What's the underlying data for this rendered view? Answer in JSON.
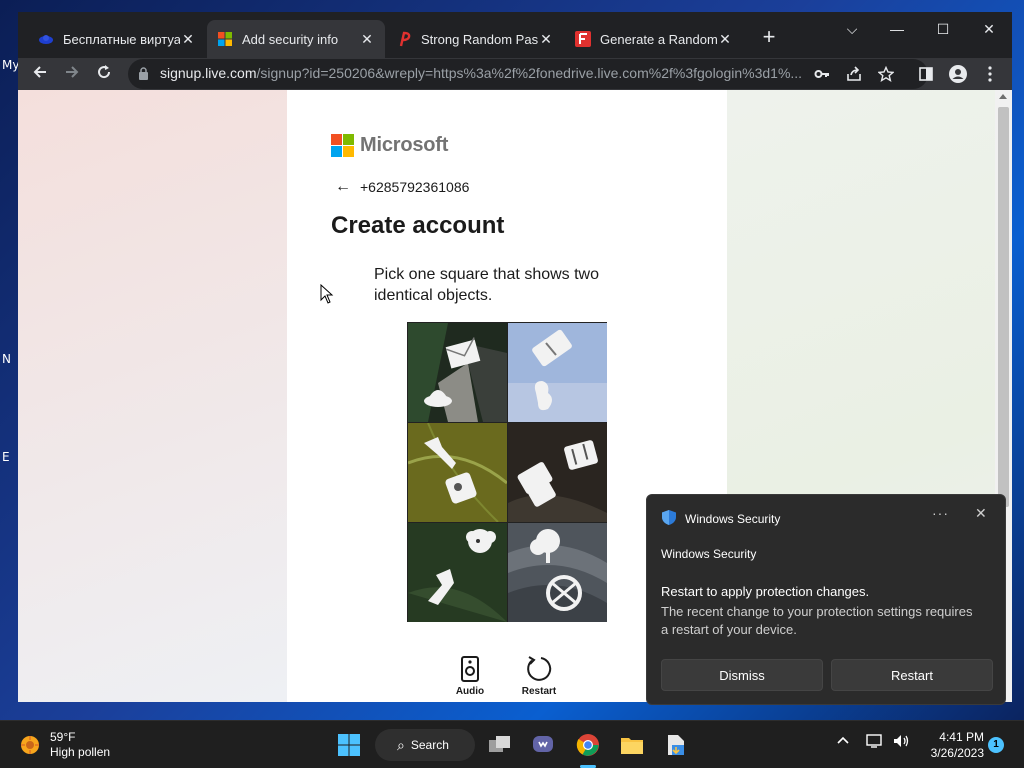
{
  "desktop": {
    "icon_labels": [
      "My",
      "N",
      "E"
    ]
  },
  "tabs": [
    {
      "title": "Бесплатные виртуал",
      "favicon": "globe-icon"
    },
    {
      "title": "Add security info",
      "favicon": "microsoft-icon",
      "active": true
    },
    {
      "title": "Strong Random Passw",
      "favicon": "p-logo-icon"
    },
    {
      "title": "Generate a Random N",
      "favicon": "f-logo-icon"
    }
  ],
  "omnibox": {
    "host": "signup.live.com",
    "path": "/signup?id=250206&wreply=https%3a%2f%2fonedrive.live.com%2f%3fgologin%3d1%..."
  },
  "page": {
    "brand": "Microsoft",
    "phone": "+6285792361086",
    "title": "Create account",
    "prompt": "Pick one square that shows two identical objects.",
    "audio_label": "Audio",
    "restart_label": "Restart"
  },
  "toast": {
    "header": "Windows Security",
    "app_name": "Windows Security",
    "headline": "Restart to apply protection changes.",
    "body": "The recent change to your protection settings requires a restart of your device.",
    "dismiss": "Dismiss",
    "restart": "Restart"
  },
  "taskbar": {
    "temperature": "59°F",
    "weather_desc": "High pollen",
    "search": "Search",
    "time": "4:41 PM",
    "date": "3/26/2023",
    "notifications": "1"
  },
  "colors": {
    "ms_red": "#f25022",
    "ms_green": "#7fba00",
    "ms_blue": "#00a4ef",
    "ms_yellow": "#ffb900"
  }
}
